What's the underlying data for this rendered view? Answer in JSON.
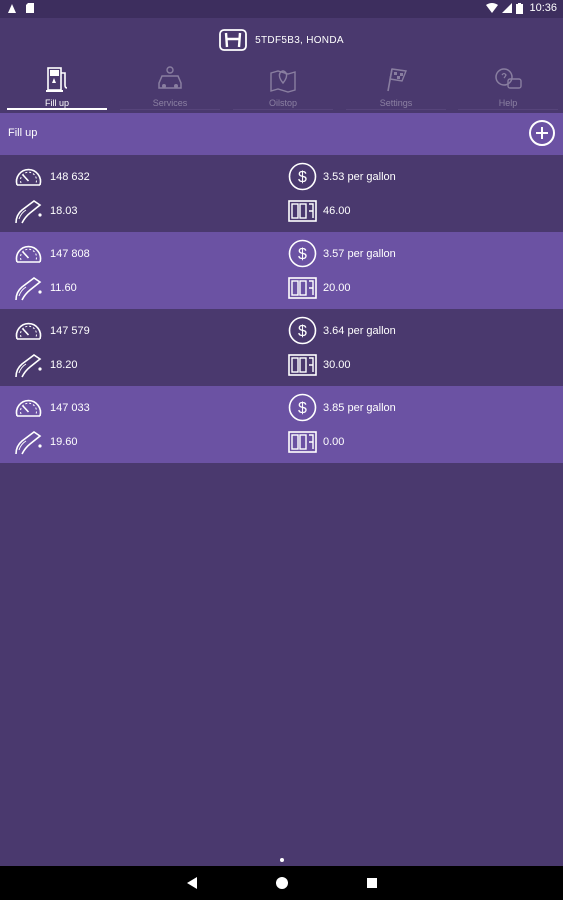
{
  "status_bar": {
    "time": "10:36"
  },
  "header": {
    "brand_icon": "honda-logo-icon",
    "title": "5TDF5B3,  HONDA"
  },
  "tabs": [
    {
      "label": "Fill up",
      "icon": "fuel-pump-icon",
      "active": true
    },
    {
      "label": "Services",
      "icon": "car-service-icon",
      "active": false
    },
    {
      "label": "Oilstop",
      "icon": "map-pin-icon",
      "active": false
    },
    {
      "label": "Settings",
      "icon": "checkered-flag-icon",
      "active": false
    },
    {
      "label": "Help",
      "icon": "help-chat-icon",
      "active": false
    }
  ],
  "section": {
    "title": "Fill up",
    "add_icon": "plus-circle-icon"
  },
  "entries": [
    {
      "odometer": "148 632",
      "price": "3.53 per gallon",
      "volume": "18.03",
      "total": "46.00"
    },
    {
      "odometer": "147 808",
      "price": "3.57 per gallon",
      "volume": "11.60",
      "total": "20.00"
    },
    {
      "odometer": "147 579",
      "price": "3.64 per gallon",
      "volume": "18.20",
      "total": "30.00"
    },
    {
      "odometer": "147 033",
      "price": "3.85 per gallon",
      "volume": "19.60",
      "total": "0.00"
    }
  ],
  "colors": {
    "background": "#4a396e",
    "row_light": "#6b52a3",
    "section_bar": "#6b52a3"
  }
}
